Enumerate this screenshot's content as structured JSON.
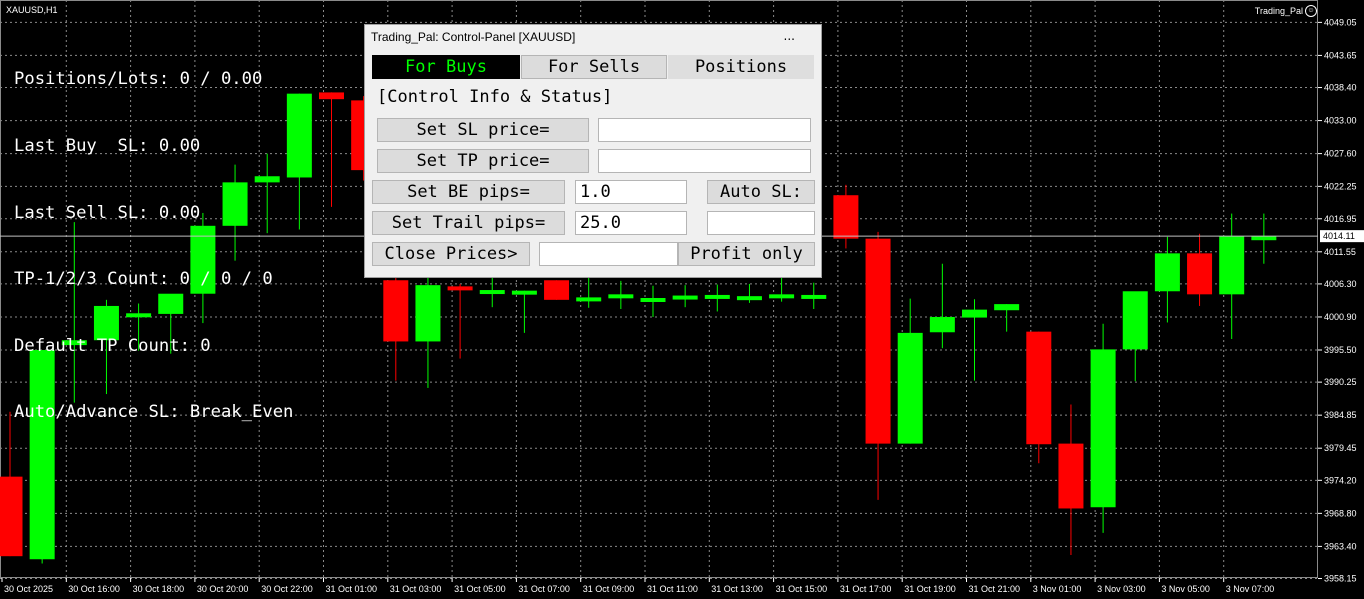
{
  "window": {
    "symbol_title": "XAUUSD,H1",
    "ea_name": "Trading_Pal"
  },
  "info": [
    "Positions/Lots: 0 / 0.00",
    "Last Buy  SL: 0.00",
    "Last Sell SL: 0.00",
    "TP-1/2/3 Count: 0 / 0 / 0",
    "Default TP Count: 0",
    "Auto/Advance SL: Break_Even"
  ],
  "panel": {
    "title": "Trading_Pal: Control-Panel  [XAUUSD]",
    "minimize": "...",
    "tabs": [
      "For Buys",
      "For Sells",
      "Positions"
    ],
    "section_label": "[Control Info & Status]",
    "set_sl_label": "Set SL price=",
    "set_sl_value": "",
    "set_tp_label": "Set TP price=",
    "set_tp_value": "",
    "set_be_label": "Set BE pips=",
    "set_be_value": "1.0",
    "auto_sl_label": "Auto SL:",
    "set_trail_label": "Set Trail pips=",
    "set_trail_value": "25.0",
    "auto_sl_value": "",
    "close_prices_label": "Close Prices>",
    "close_prices_value": "",
    "profit_only_label": "Profit only"
  },
  "colors": {
    "bull": "#00ff00",
    "bear": "#ff0000",
    "grid": "#8a8a8a",
    "text": "#ffffff",
    "background": "#000000",
    "tab_active_text": "#00ff00"
  },
  "chart_data": {
    "type": "candlestick",
    "symbol": "XAUUSD",
    "timeframe": "H1",
    "ylim": [
      3956.6,
      4051.4
    ],
    "grid": true,
    "y_ticks": [
      "4049.05",
      "4043.65",
      "4038.40",
      "4033.00",
      "4027.60",
      "4022.25",
      "4016.95",
      "4011.55",
      "4006.30",
      "4000.90",
      "3995.50",
      "3990.25",
      "3984.85",
      "3979.45",
      "3974.20",
      "3968.80",
      "3963.40",
      "3958.15"
    ],
    "x_labels": [
      "30 Oct 2025",
      "30 Oct 16:00",
      "30 Oct 18:00",
      "30 Oct 20:00",
      "30 Oct 22:00",
      "31 Oct 01:00",
      "31 Oct 03:00",
      "31 Oct 05:00",
      "31 Oct 07:00",
      "31 Oct 09:00",
      "31 Oct 11:00",
      "31 Oct 13:00",
      "31 Oct 15:00",
      "31 Oct 17:00",
      "31 Oct 19:00",
      "31 Oct 21:00",
      "3 Nov 01:00",
      "3 Nov 03:00",
      "3 Nov 05:00",
      "3 Nov 07:00"
    ],
    "current_price": "4014.11",
    "candles": [
      {
        "o": 3974.8,
        "h": 3985.4,
        "l": 3961.8,
        "c": 3961.8
      },
      {
        "o": 3961.3,
        "h": 3995.5,
        "l": 3960.6,
        "c": 3995.5
      },
      {
        "o": 3996.3,
        "h": 4016.4,
        "l": 3986.9,
        "c": 3997.1
      },
      {
        "o": 3997.1,
        "h": 4003.7,
        "l": 3988.3,
        "c": 4002.7
      },
      {
        "o": 4001.4,
        "h": 4003.1,
        "l": 3995.4,
        "c": 4001.5
      },
      {
        "o": 4001.4,
        "h": 4003.4,
        "l": 3994.9,
        "c": 4004.7
      },
      {
        "o": 4004.7,
        "h": 4017.9,
        "l": 3999.9,
        "c": 4015.8
      },
      {
        "o": 4015.8,
        "h": 4025.8,
        "l": 4010.1,
        "c": 4022.9
      },
      {
        "o": 4022.9,
        "h": 4027.6,
        "l": 4014.6,
        "c": 4023.9
      },
      {
        "o": 4023.7,
        "h": 4037.4,
        "l": 4015.2,
        "c": 4037.4
      },
      {
        "o": 4037.6,
        "h": 4037.6,
        "l": 4018.9,
        "c": 4036.5
      },
      {
        "o": 4036.3,
        "h": 4037.0,
        "l": 4023.2,
        "c": 4024.9
      },
      {
        "o": 4006.9,
        "h": 4009.6,
        "l": 3990.5,
        "c": 3996.9
      },
      {
        "o": 3996.9,
        "h": 4009.6,
        "l": 3989.3,
        "c": 4006.1
      },
      {
        "o": 4005.9,
        "h": 4006.3,
        "l": 3994.1,
        "c": 4005.4
      },
      {
        "o": 4005.3,
        "h": 4009.7,
        "l": 4002.5,
        "c": 4005.3
      },
      {
        "o": 4005.2,
        "h": 4005.2,
        "l": 3998.3,
        "c": 4005.2
      },
      {
        "o": 4006.9,
        "h": 4006.9,
        "l": 4003.7,
        "c": 4003.7
      },
      {
        "o": 4004.1,
        "h": 4007.6,
        "l": 4002.4,
        "c": 4004.1
      },
      {
        "o": 4004.6,
        "h": 4006.8,
        "l": 4002.2,
        "c": 4004.6
      },
      {
        "o": 4004.0,
        "h": 4006.0,
        "l": 4000.9,
        "c": 4004.0
      },
      {
        "o": 4004.4,
        "h": 4006.1,
        "l": 4002.5,
        "c": 4004.4
      },
      {
        "o": 4004.5,
        "h": 4006.2,
        "l": 4001.8,
        "c": 4004.5
      },
      {
        "o": 4004.3,
        "h": 4006.3,
        "l": 4003.2,
        "c": 4004.3
      },
      {
        "o": 4004.6,
        "h": 4007.3,
        "l": 4003.4,
        "c": 4004.6
      },
      {
        "o": 4004.5,
        "h": 4006.5,
        "l": 4002.2,
        "c": 4004.5
      },
      {
        "o": 4020.8,
        "h": 4022.5,
        "l": 4012.1,
        "c": 4013.7
      },
      {
        "o": 4013.7,
        "h": 4014.8,
        "l": 3971.0,
        "c": 3980.2
      },
      {
        "o": 3980.2,
        "h": 4003.9,
        "l": 3980.2,
        "c": 3998.3
      },
      {
        "o": 3998.4,
        "h": 4009.6,
        "l": 3995.8,
        "c": 4000.9
      },
      {
        "o": 4000.8,
        "h": 4003.8,
        "l": 3990.5,
        "c": 4002.1
      },
      {
        "o": 4002.0,
        "h": 4003.0,
        "l": 3998.5,
        "c": 4003.0
      },
      {
        "o": 3998.5,
        "h": 3998.5,
        "l": 3977.0,
        "c": 3980.1
      },
      {
        "o": 3980.2,
        "h": 3986.6,
        "l": 3962.0,
        "c": 3969.6
      },
      {
        "o": 3969.8,
        "h": 3999.8,
        "l": 3965.6,
        "c": 3995.6
      },
      {
        "o": 3995.6,
        "h": 4004.8,
        "l": 3990.4,
        "c": 4005.1
      },
      {
        "o": 4005.1,
        "h": 4014.0,
        "l": 4000.0,
        "c": 4011.3
      },
      {
        "o": 4011.3,
        "h": 4014.5,
        "l": 4002.7,
        "c": 4004.6
      },
      {
        "o": 4004.6,
        "h": 4017.8,
        "l": 3997.3,
        "c": 4014.1
      },
      {
        "o": 4014.1,
        "h": 4017.8,
        "l": 4009.6,
        "c": 4014.1
      }
    ]
  }
}
